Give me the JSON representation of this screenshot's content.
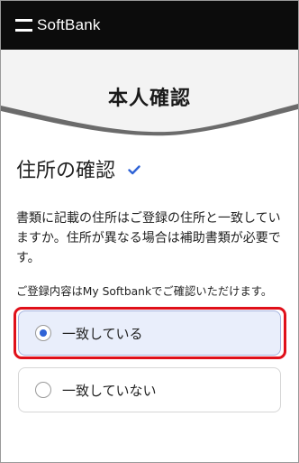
{
  "header": {
    "brand": "SoftBank"
  },
  "hero": {
    "title": "本人確認"
  },
  "section": {
    "title": "住所の確認",
    "description": "書類に記載の住所はご登録の住所と一致していますか。住所が異なる場合は補助書類が必要です。",
    "note": "ご登録内容はMy Softbankでご確認いただけます。"
  },
  "options": [
    {
      "label": "一致している",
      "selected": true
    },
    {
      "label": "一致していない",
      "selected": false
    }
  ],
  "colors": {
    "header_bg": "#0c0c0c",
    "check": "#2f63d6",
    "selected_bg": "#e9eefb",
    "highlight_border": "#e0101a"
  }
}
